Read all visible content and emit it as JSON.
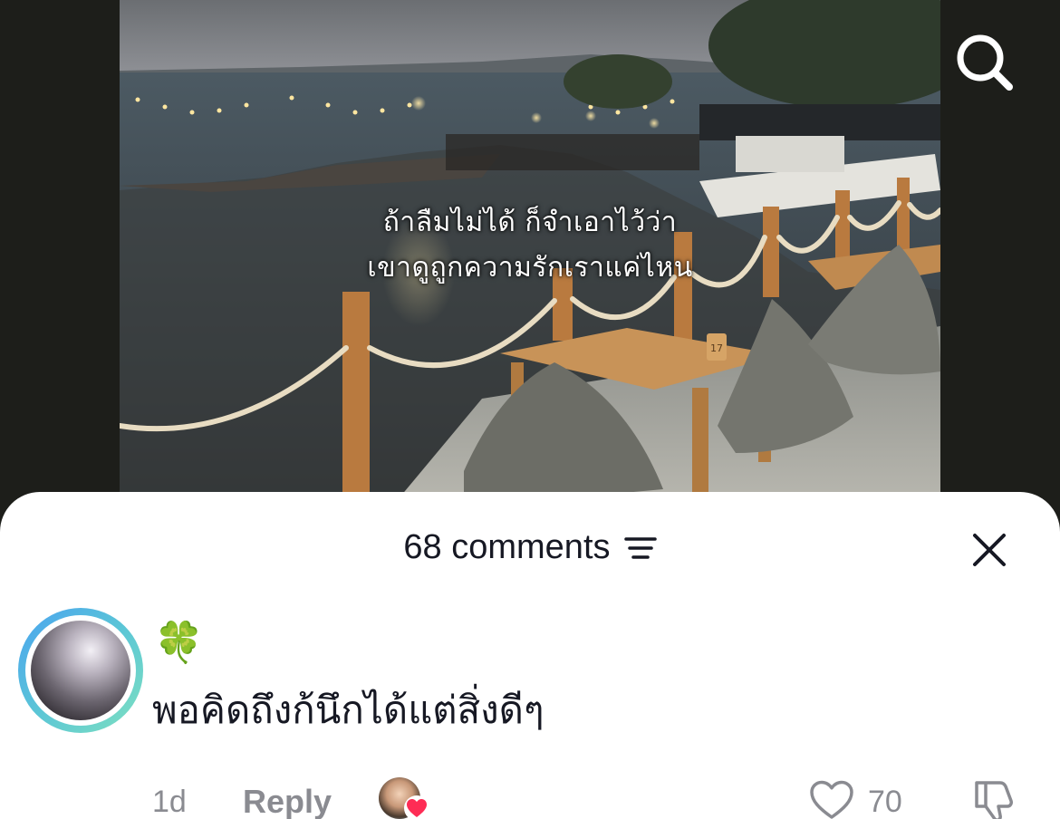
{
  "video": {
    "caption_line1": "ถ้าลืมไม่ได้ ก็จำเอาไว้ว่า",
    "caption_line2": "เขาดูถูกความรักเราแค่ไหน",
    "table_number": "17"
  },
  "header": {
    "search_icon": "search-icon"
  },
  "comments_sheet": {
    "count_label": "68 comments",
    "filter_icon": "sort-filter-icon",
    "close_icon": "close-icon",
    "comments": [
      {
        "username": "🍀",
        "text": "พอคิดถึงก้นึกได้แต่สิ่งดีๆ",
        "time": "1d",
        "reply_label": "Reply",
        "like_count": "70",
        "liked_by_creator": true
      }
    ]
  },
  "colors": {
    "background": "#1d1e1a",
    "sheet": "#ffffff",
    "text_primary": "#161823",
    "text_secondary": "#8a8b91",
    "heart_red": "#fe2c55",
    "avatar_ring_start": "#4aa3f0",
    "avatar_ring_end": "#7ee0c0"
  }
}
